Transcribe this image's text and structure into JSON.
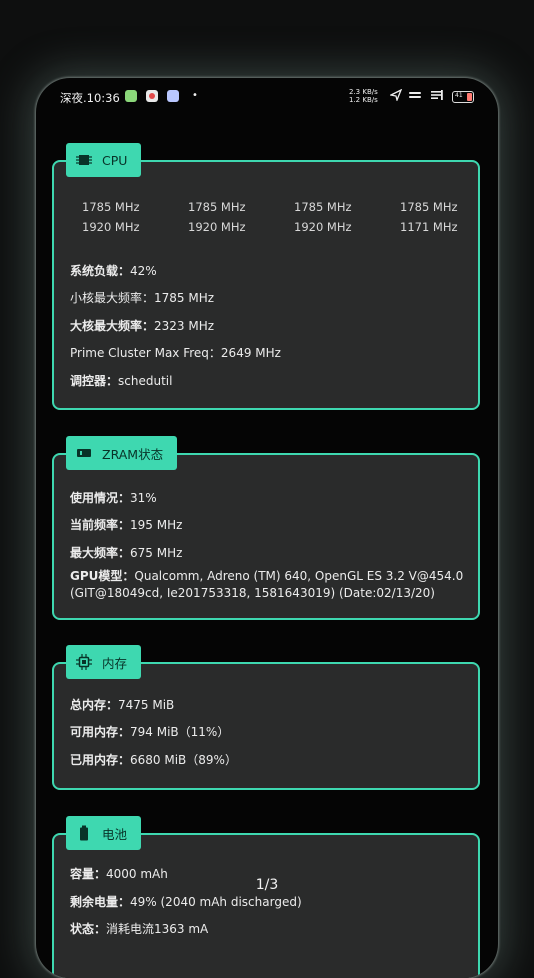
{
  "status_bar": {
    "time": "深夜.10:36",
    "dot": "•",
    "net_up": "2.3 KB/s",
    "net_down": "1.2 KB/s",
    "battery_level": "41",
    "colors": {
      "app1": "#8bd77a",
      "app2": "#e9e9e9",
      "app3": "#b9c7ff"
    }
  },
  "cpu": {
    "title": "CPU",
    "freqs": [
      "1785 MHz",
      "1785 MHz",
      "1785 MHz",
      "1785 MHz",
      "1920 MHz",
      "1920 MHz",
      "1920 MHz",
      "1171 MHz"
    ],
    "load_label": "系统负载：",
    "load_value": "42%",
    "small_label": "小核最大频率：",
    "small_value": "1785 MHz",
    "big_label": "大核最大频率：",
    "big_value": "2323 MHz",
    "prime_label": "Prime Cluster Max Freq：",
    "prime_value": "2649 MHz",
    "gov_label": "调控器：",
    "gov_value": "schedutil"
  },
  "zram": {
    "title": "ZRAM状态",
    "usage_label": "使用情况：",
    "usage_value": "31%",
    "cur_label": "当前频率：",
    "cur_value": "195 MHz",
    "max_label": "最大频率：",
    "max_value": "675 MHz",
    "gpu_label": "GPU模型：",
    "gpu_value_line1": "Qualcomm, Adreno (TM) 640, OpenGL ES 3.2 V@454.0",
    "gpu_value_line2": "(GIT@18049cd, Ie201753318, 1581643019) (Date:02/13/20)"
  },
  "memory": {
    "title": "内存",
    "total_label": "总内存：",
    "total_value": "7475 MiB",
    "avail_label": "可用内存：",
    "avail_value": "794 MiB（11%）",
    "used_label": "已用内存：",
    "used_value": "6680 MiB（89%）"
  },
  "battery": {
    "title": "电池",
    "capacity_label": "容量：",
    "capacity_value": "4000 mAh",
    "remain_label": "剩余电量：",
    "remain_value": "49% (2040 mAh discharged)",
    "state_label": "状态：",
    "state_value": "消耗电流1363 mA"
  },
  "pager": {
    "indicator": "1/3"
  },
  "theme": {
    "accent": "#3ed8b0",
    "card_bg": "#2a2b2b"
  }
}
